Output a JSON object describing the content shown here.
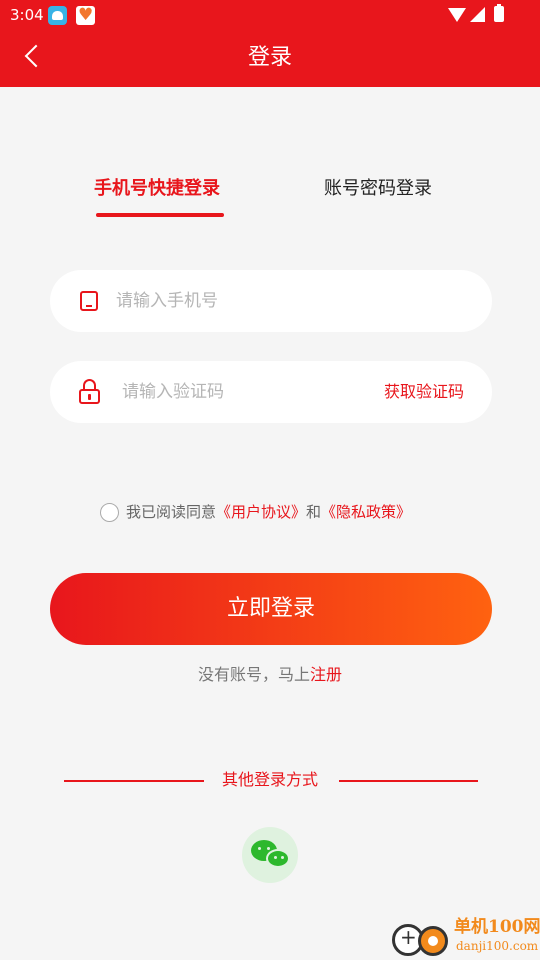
{
  "colors": {
    "primary": "#e8161c",
    "gradient_end": "#ff6210",
    "background": "#f5f5f5"
  },
  "status_bar": {
    "time": "3:04"
  },
  "header": {
    "title": "登录",
    "back_icon": "chevron-left-icon"
  },
  "tabs": [
    {
      "label": "手机号快捷登录",
      "active": true
    },
    {
      "label": "账号密码登录",
      "active": false
    }
  ],
  "form": {
    "phone": {
      "placeholder": "请输入手机号",
      "value": "",
      "icon": "phone-icon"
    },
    "code": {
      "placeholder": "请输入验证码",
      "value": "",
      "icon": "lock-icon",
      "get_code_label": "获取验证码"
    }
  },
  "agreement": {
    "checked": false,
    "prefix": "我已阅读同意",
    "user_agreement": "《用户协议》",
    "conjunction": "和",
    "privacy_policy": "《隐私政策》"
  },
  "login_button": {
    "label": "立即登录"
  },
  "register": {
    "prefix": "没有账号，马上",
    "link": "注册"
  },
  "other_login": {
    "label": "其他登录方式",
    "wechat_icon": "wechat-icon"
  },
  "watermark": {
    "title": "单机100网",
    "url": "danji100.com"
  }
}
